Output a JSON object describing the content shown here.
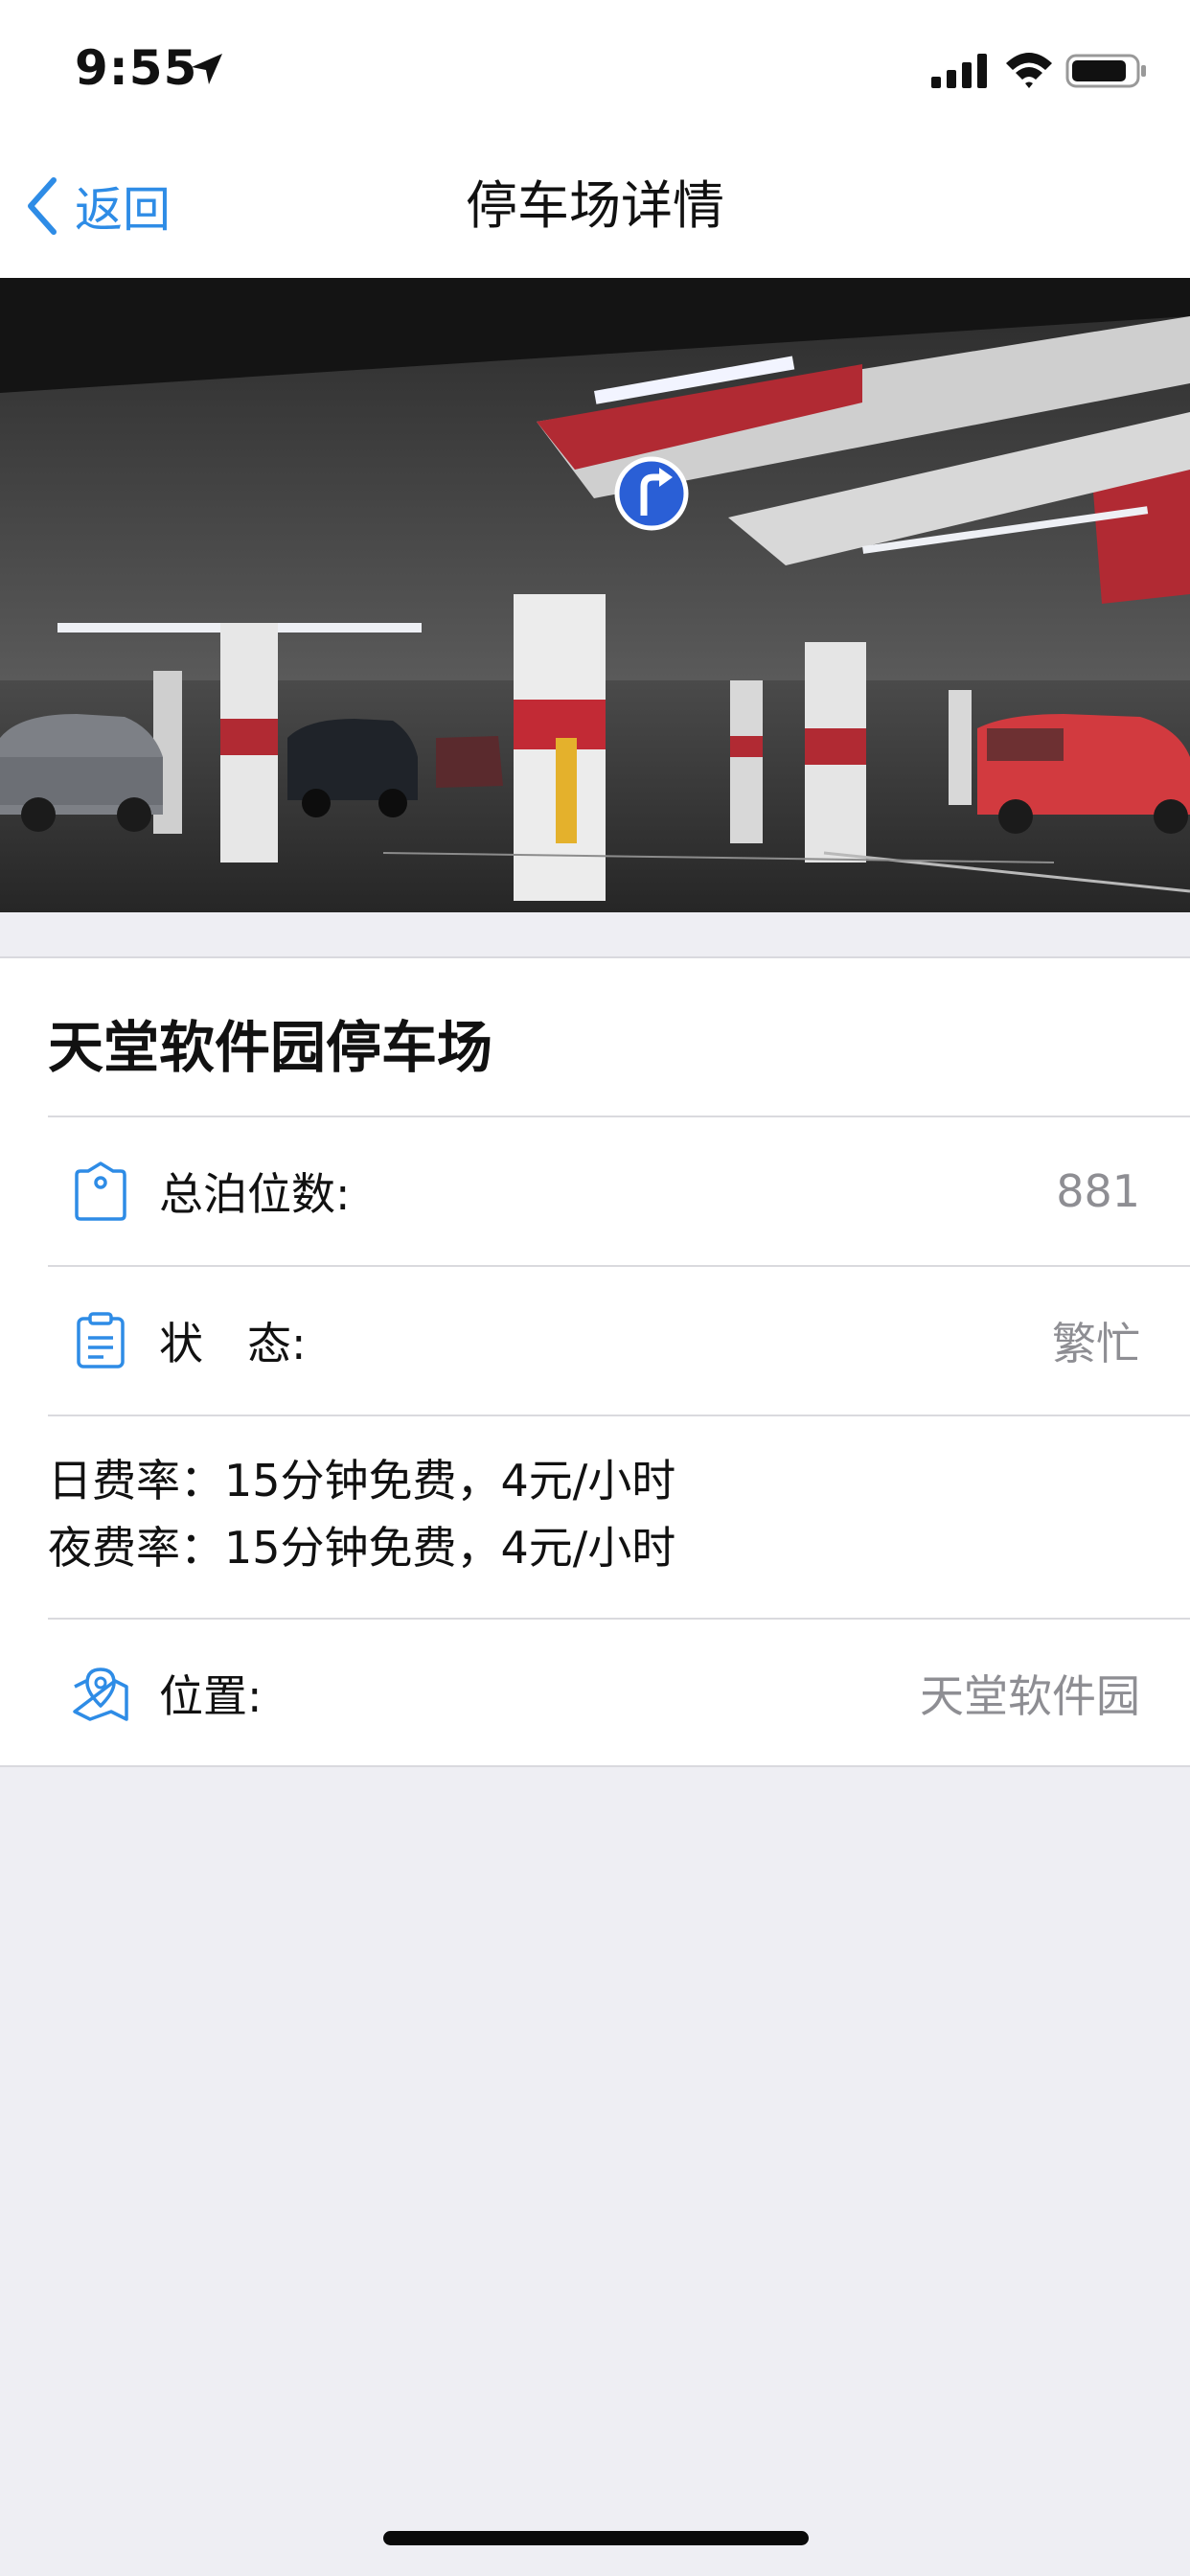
{
  "status_bar": {
    "time": "9:55"
  },
  "nav": {
    "back_label": "返回",
    "title": "停车场详情"
  },
  "parking": {
    "name": "天堂软件园停车场",
    "total_spaces_label": "总泊位数:",
    "total_spaces_value": "881",
    "status_label": "状　态:",
    "status_value": "繁忙",
    "day_rate": "日费率：15分钟免费，4元/小时",
    "night_rate": "夜费率：15分钟免费，4元/小时",
    "location_label": "位置:",
    "location_value": "天堂软件园"
  },
  "colors": {
    "accent": "#2e8ce6",
    "background": "#eeeef3",
    "muted_text": "#8e8e93"
  },
  "icons": [
    "location-arrow-icon",
    "signal-icon",
    "wifi-icon",
    "battery-icon",
    "chevron-left-icon",
    "tag-icon",
    "clipboard-icon",
    "map-pin-icon"
  ]
}
